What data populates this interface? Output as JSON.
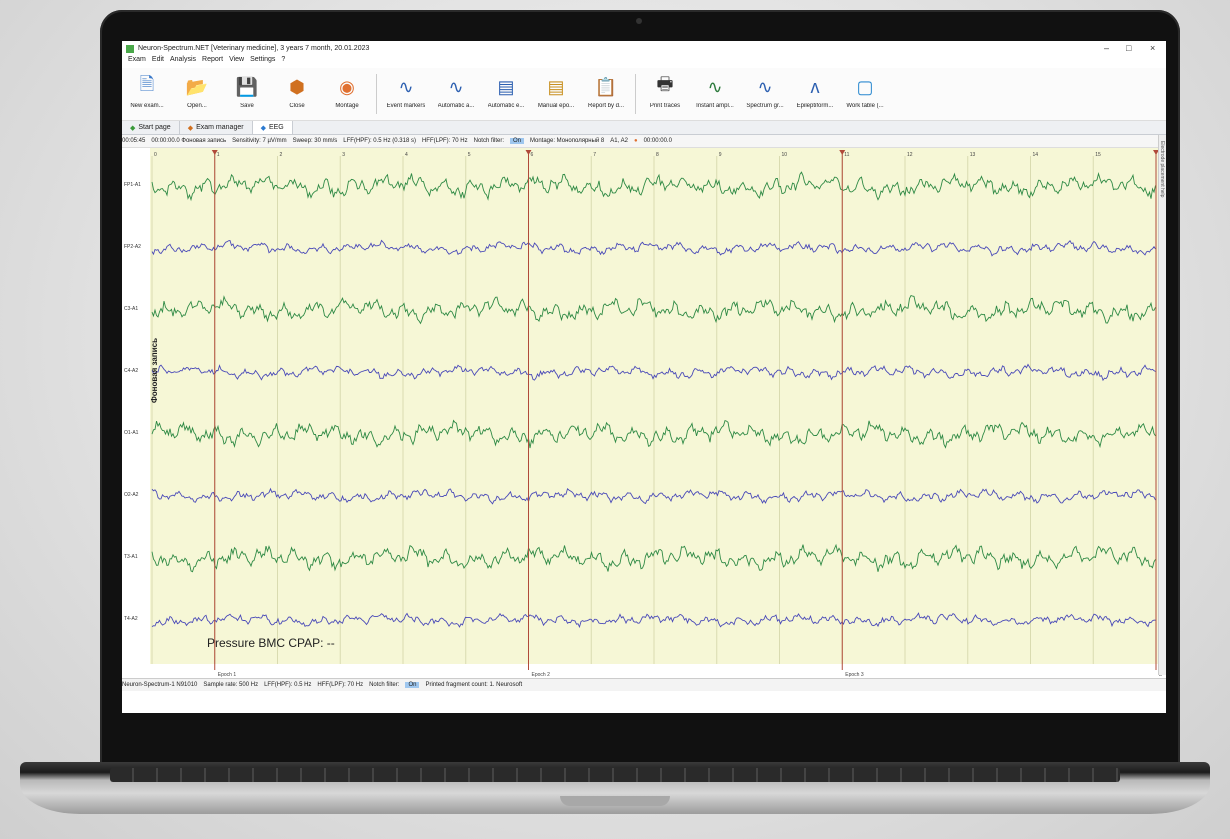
{
  "window": {
    "title": "Neuron-Spectrum.NET [Veterinary medicine], 3 years 7 month, 20.01.2023",
    "minimize": "–",
    "maximize": "□",
    "close": "×"
  },
  "menu": [
    "Exam",
    "Edit",
    "Analysis",
    "Report",
    "View",
    "Settings",
    "?"
  ],
  "toolbar": [
    {
      "label": "New exam...",
      "icon": "new-exam-icon",
      "glyph": "🗎",
      "color": "#3a78c8"
    },
    {
      "label": "Open...",
      "icon": "open-icon",
      "glyph": "📂",
      "color": "#d08020"
    },
    {
      "label": "Save",
      "icon": "save-icon",
      "glyph": "💾",
      "color": "#3a78c8"
    },
    {
      "label": "Close",
      "icon": "close-exam-icon",
      "glyph": "⬢",
      "color": "#d07020"
    },
    {
      "label": "Montage",
      "icon": "montage-brain-icon",
      "glyph": "◉",
      "color": "#e07030"
    },
    {
      "label": "Event markers",
      "icon": "event-markers-icon",
      "glyph": "∿",
      "color": "#2c5fb0"
    },
    {
      "label": "Automatic a...",
      "icon": "automatic-analysis-icon",
      "glyph": "∿",
      "color": "#2c5fb0"
    },
    {
      "label": "Automatic e...",
      "icon": "automatic-epoch-icon",
      "glyph": "▤",
      "color": "#2c5fb0"
    },
    {
      "label": "Manual epo...",
      "icon": "manual-epoch-icon",
      "glyph": "▤",
      "color": "#c89020"
    },
    {
      "label": "Report by d...",
      "icon": "report-icon",
      "glyph": "📋",
      "color": "#c89020"
    },
    {
      "label": "Print traces",
      "icon": "printer-icon",
      "glyph": "🖶",
      "color": "#333333"
    },
    {
      "label": "Instant ampl...",
      "icon": "instant-amplitude-icon",
      "glyph": "∿",
      "color": "#2c7a3c"
    },
    {
      "label": "Spectrum gr...",
      "icon": "spectrum-icon",
      "glyph": "∿",
      "color": "#2c5fb0"
    },
    {
      "label": "Epileptiform...",
      "icon": "epileptiform-icon",
      "glyph": "ᴧ",
      "color": "#2c5fb0"
    },
    {
      "label": "Work table (...",
      "icon": "work-table-icon",
      "glyph": "▢",
      "color": "#2c8ad0"
    }
  ],
  "tabs": [
    {
      "label": "Start page",
      "icon": "start-page-icon"
    },
    {
      "label": "Exam manager",
      "icon": "exam-manager-icon"
    },
    {
      "label": "EEG",
      "icon": "eeg-icon",
      "active": true
    }
  ],
  "params": {
    "time": "00:05:45",
    "record": "00:00:00.0 Фоновая запись",
    "sensitivity": "Sensitivity: 7 µV/mm",
    "sweep": "Sweep: 30 mm/s",
    "lff": "LFF(HPF): 0.5 Hz (0.318 s)",
    "hff": "HFF(LPF): 70 Hz",
    "notch": "Notch filter:",
    "notch_state": "On",
    "montage": "Montage: Монополярный 8",
    "ref": "A1, A2",
    "timer": "00:00:00.0"
  },
  "channels": [
    "FP1-A1",
    "FP2-A2",
    "C3-A1",
    "C4-A2",
    "O1-A1",
    "O2-A2",
    "T3-A1",
    "T4-A2"
  ],
  "channel_colors": [
    "#2f8a45",
    "#4a4ab8",
    "#2f8a45",
    "#4a4ab8",
    "#2f8a45",
    "#4a4ab8",
    "#2f8a45",
    "#4a4ab8"
  ],
  "second_ticks": [
    "0",
    "1",
    "2",
    "3",
    "4",
    "5",
    "6",
    "7",
    "8",
    "9",
    "10",
    "11",
    "12",
    "13",
    "14",
    "15",
    "16"
  ],
  "epochs": [
    {
      "label": "Epoch 1",
      "second": 1
    },
    {
      "label": "Epoch 2",
      "second": 6
    },
    {
      "label": "Epoch 3",
      "second": 11
    },
    {
      "label": "Epoch",
      "second": 16
    }
  ],
  "side_label": "Фоновая запись",
  "pressure_text": "Pressure BMC CPAP: --",
  "right_panel_label": "Electrode placement help",
  "status": {
    "device": "Neuron-Spectrum-1 N91010",
    "sample_rate": "Sample rate: 500 Hz",
    "lff": "LFF(HPF): 0.5 Hz",
    "hff": "HFF(LPF): 70 Hz",
    "notch": "Notch filter:",
    "notch_state": "On",
    "printed": "Printed fragment count: 1. Neurosoft"
  }
}
